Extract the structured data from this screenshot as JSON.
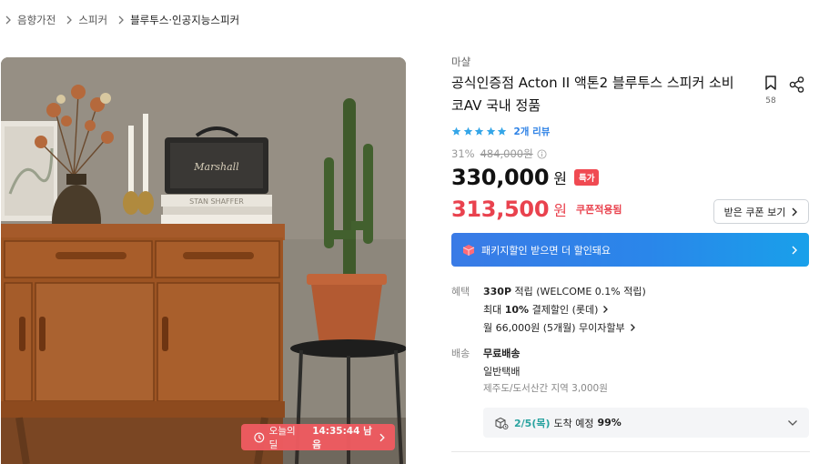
{
  "breadcrumb": {
    "items": [
      "음향가전",
      "스피커",
      "블루투스·인공지능스피커"
    ]
  },
  "image": {
    "speaker_brand": "Marshall",
    "book_text": "STAN SHAFFER",
    "deal_timer": {
      "label": "오늘의딜",
      "time": "14:35:44 남음",
      "color": "#ef5b61"
    }
  },
  "product": {
    "brand": "마샬",
    "title": "공식인증점 Acton II 액톤2 블루투스 스피커 소비코AV 국내 정품",
    "bookmark_count": "58",
    "rating": 5,
    "review_link": "2개 리뷰",
    "discount_rate": "31%",
    "original_price": "484,000원",
    "price": "330,000",
    "price_unit": "원",
    "special_tag": "특가",
    "coupon_price": "313,500",
    "coupon_unit": "원",
    "coupon_applied": "쿠폰적용됨",
    "coupon_button": "받은 쿠폰 보기"
  },
  "package_banner": {
    "text": "패키지할인 받으면 더 할인돼요",
    "color": "#2a86ea"
  },
  "benefits": {
    "label": "혜택",
    "points_value": "330P",
    "points_text": "적립 (WELCOME 0.1% 적립)",
    "card_prefix": "최대",
    "card_rate": "10%",
    "card_text": "결제할인 (롯데)",
    "installment": "월 66,000원 (5개월) 무이자할부"
  },
  "delivery": {
    "label": "배송",
    "fee": "무료배송",
    "method": "일반택배",
    "extra": "제주도/도서산간 지역 3,000원",
    "eta_date": "2/5(목)",
    "eta_text": "도착 예정",
    "eta_pct": "99%"
  },
  "colors": {
    "accent_red": "#e9424e",
    "review_blue": "#2e82e6",
    "eta_teal": "#2aa3a0"
  }
}
